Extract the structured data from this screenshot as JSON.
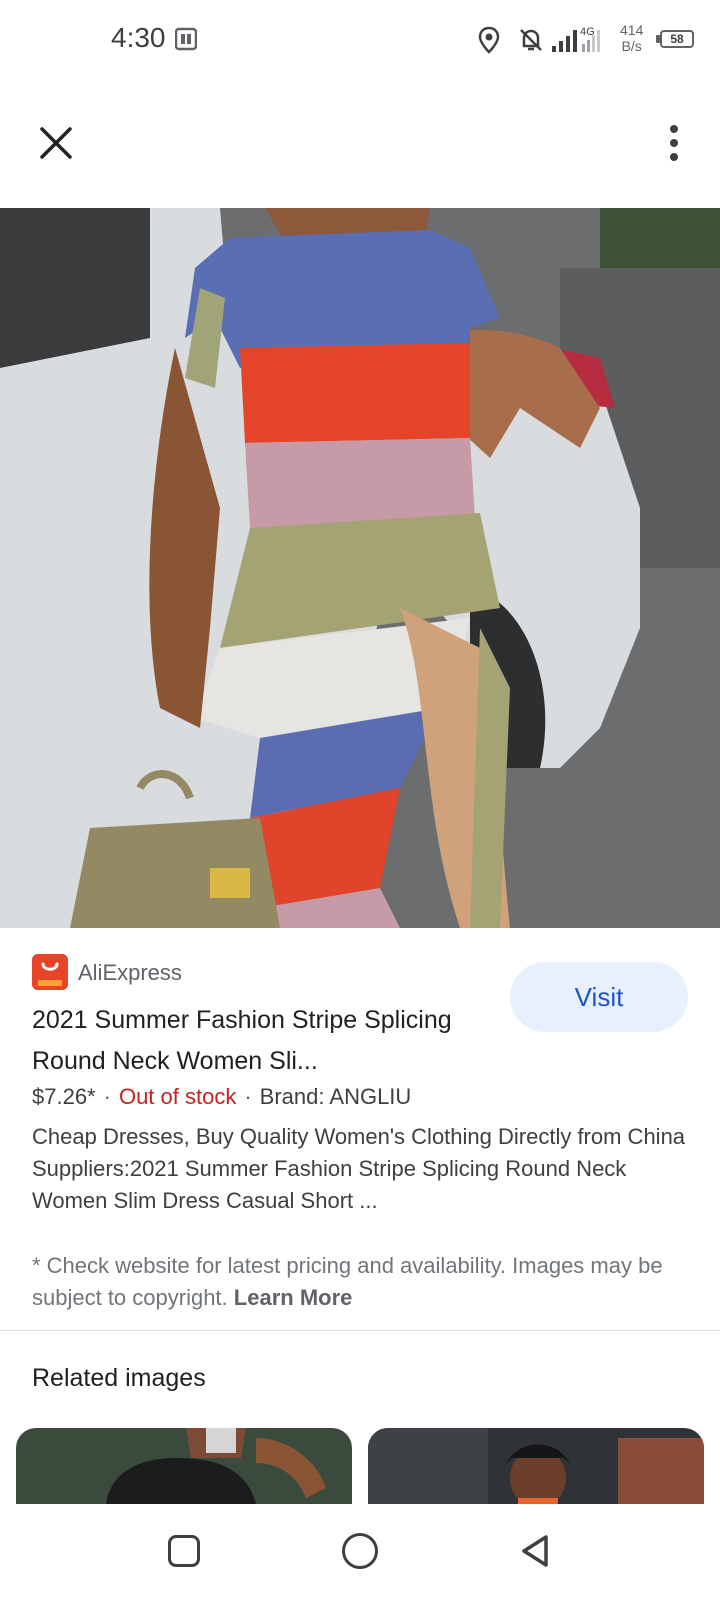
{
  "status_bar": {
    "time": "4:30",
    "net_speed_value": "414",
    "net_speed_unit": "B/s",
    "network_type": "4G",
    "battery": "58",
    "icons": [
      "sim-icon",
      "location-icon",
      "bell-off-icon",
      "signal-icon",
      "battery-icon"
    ]
  },
  "top_bar": {
    "close_icon": "close-icon",
    "more_icon": "more-vert-icon"
  },
  "result": {
    "source": "AliExpress",
    "visit_label": "Visit",
    "title": "2021 Summer Fashion Stripe Splicing Round Neck Women Sli...",
    "price": "$7.26*",
    "stock": "Out of stock",
    "brand": "Brand: ANGLIU",
    "description": "Cheap Dresses, Buy Quality Women's Clothing Directly from China Suppliers:2021 Summer Fashion Stripe Splicing Round Neck Women Slim Dress Casual Short ...",
    "notice": "* Check website for latest pricing and availability. Images may be subject to copyright.",
    "learn_more": "Learn More"
  },
  "related": {
    "title": "Related images"
  },
  "colors": {
    "accent": "#1a55c6",
    "visit_bg": "#e8f0fe",
    "out_of_stock": "#c5221f",
    "source_logo": "#e8442a"
  }
}
